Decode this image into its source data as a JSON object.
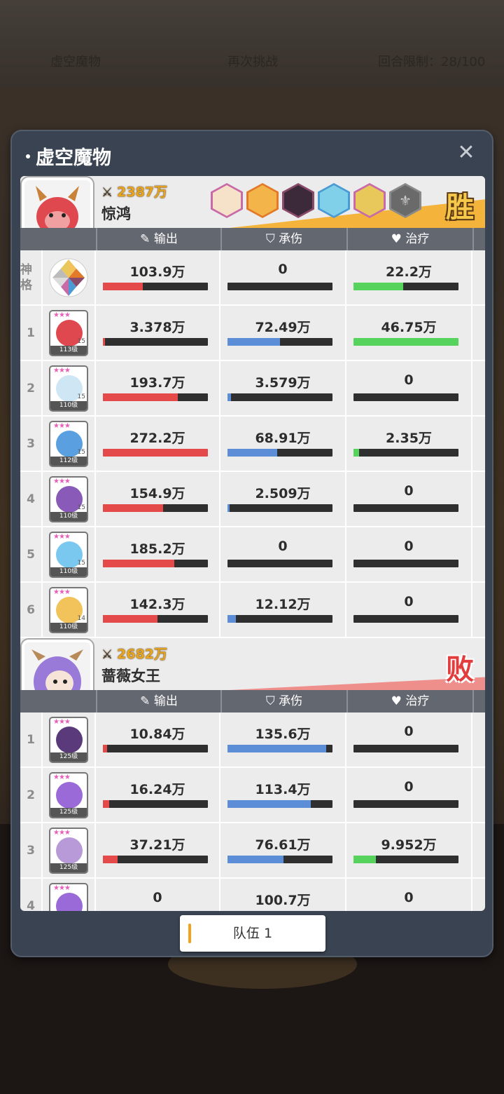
{
  "background": {
    "left_text": "虚空魔物",
    "center_text": "再次挑战",
    "right_text": "回合限制：28/100"
  },
  "panel": {
    "title": "虚空魔物"
  },
  "columns": {
    "output": "输出",
    "tank": "承伤",
    "heal": "治疗"
  },
  "team1": {
    "power": "2387万",
    "name": "惊鸿",
    "result": "胜",
    "gods": [
      "god-icon-1",
      "god-icon-2",
      "god-icon-3",
      "god-icon-4",
      "god-icon-5",
      "god-icon-locked"
    ],
    "rows": [
      {
        "idx": "神格",
        "level": "",
        "output": "103.9万",
        "out_frac": 0.38,
        "tank": "0",
        "tank_frac": 0,
        "heal": "22.2万",
        "heal_frac": 0.47
      },
      {
        "idx": "1",
        "level": "113级",
        "plus": "15",
        "output": "3.378万",
        "out_frac": 0.02,
        "tank": "72.49万",
        "tank_frac": 0.5,
        "heal": "46.75万",
        "heal_frac": 1.0
      },
      {
        "idx": "2",
        "level": "110级",
        "plus": "15",
        "output": "193.7万",
        "out_frac": 0.71,
        "tank": "3.579万",
        "tank_frac": 0.03,
        "heal": "0",
        "heal_frac": 0
      },
      {
        "idx": "3",
        "level": "112级",
        "plus": "15",
        "output": "272.2万",
        "out_frac": 1.0,
        "tank": "68.91万",
        "tank_frac": 0.47,
        "heal": "2.35万",
        "heal_frac": 0.05
      },
      {
        "idx": "4",
        "level": "110级",
        "plus": "15",
        "output": "154.9万",
        "out_frac": 0.57,
        "tank": "2.509万",
        "tank_frac": 0.02,
        "heal": "0",
        "heal_frac": 0
      },
      {
        "idx": "5",
        "level": "110级",
        "plus": "15",
        "output": "185.2万",
        "out_frac": 0.68,
        "tank": "0",
        "tank_frac": 0,
        "heal": "0",
        "heal_frac": 0
      },
      {
        "idx": "6",
        "level": "110级",
        "plus": "14",
        "output": "142.3万",
        "out_frac": 0.52,
        "tank": "12.12万",
        "tank_frac": 0.08,
        "heal": "0",
        "heal_frac": 0
      }
    ]
  },
  "team2": {
    "power": "2682万",
    "name": "蔷薇女王",
    "result": "败",
    "rows": [
      {
        "idx": "1",
        "level": "125级",
        "output": "10.84万",
        "out_frac": 0.04,
        "tank": "135.6万",
        "tank_frac": 0.94,
        "heal": "0",
        "heal_frac": 0
      },
      {
        "idx": "2",
        "level": "125级",
        "output": "16.24万",
        "out_frac": 0.06,
        "tank": "113.4万",
        "tank_frac": 0.79,
        "heal": "0",
        "heal_frac": 0
      },
      {
        "idx": "3",
        "level": "125级",
        "output": "37.21万",
        "out_frac": 0.14,
        "tank": "76.61万",
        "tank_frac": 0.53,
        "heal": "9.952万",
        "heal_frac": 0.21
      },
      {
        "idx": "4",
        "level": "",
        "output": "0",
        "out_frac": 0,
        "tank": "100.7万",
        "tank_frac": 0.7,
        "heal": "0",
        "heal_frac": 0
      }
    ]
  },
  "tab": {
    "label": "队伍 1"
  },
  "colors": {
    "output": "#e44a4a",
    "tank": "#5b8ed6",
    "heal": "#55d35c",
    "win": "#f4b33b",
    "lose": "#ef8f8c"
  }
}
